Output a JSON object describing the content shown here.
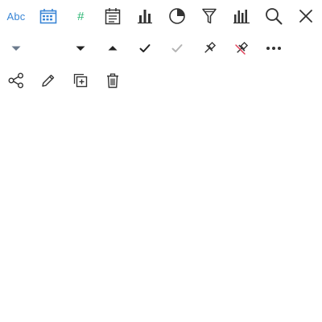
{
  "icons": {
    "text_type_label": "Abc",
    "number_type_label": "#",
    "row1": [
      "text-type-icon",
      "date-type-icon",
      "number-type-icon",
      "calendar-icon",
      "bar-chart-icon",
      "pie-chart-icon",
      "filter-icon",
      "histogram-icon",
      "search-icon",
      "close-icon"
    ],
    "row2": [
      "caret-down-muted-icon",
      "caret-down-icon",
      "caret-up-icon",
      "checkmark-icon",
      "checkmark-disabled-icon",
      "pin-icon",
      "unpin-icon",
      "more-options-icon"
    ],
    "row3": [
      "share-icon",
      "edit-icon",
      "duplicate-icon",
      "delete-icon"
    ]
  },
  "colors": {
    "icon_default": "#333333",
    "text_type": "#3a86d6",
    "date_type": "#3a86d6",
    "number_type": "#2bb673",
    "muted": "#6b7a8c",
    "disabled": "#b5b5b5",
    "unpin_accent": "#e0405a"
  }
}
